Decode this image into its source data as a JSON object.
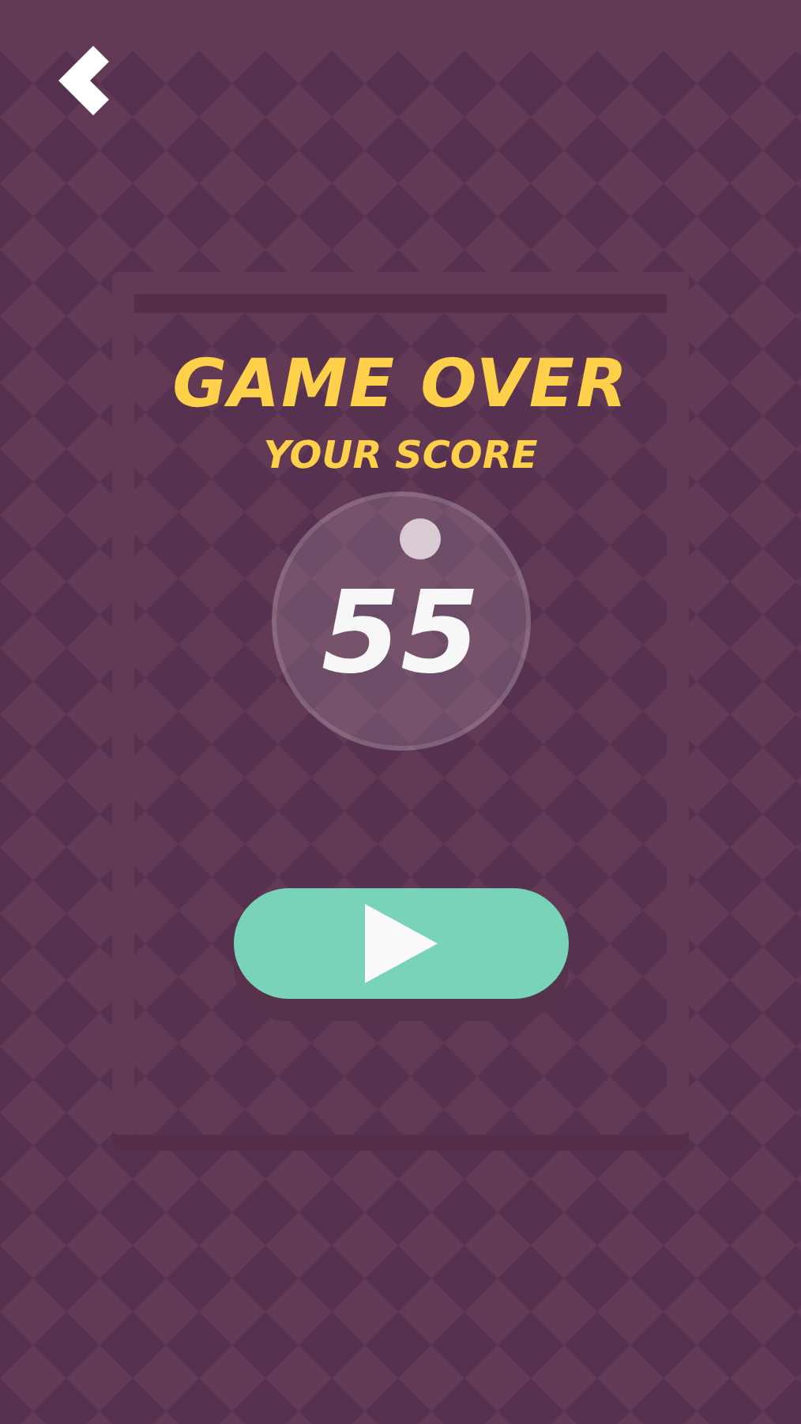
{
  "title": "GAME OVER",
  "score_label": "YOUR SCORE",
  "score": "55"
}
